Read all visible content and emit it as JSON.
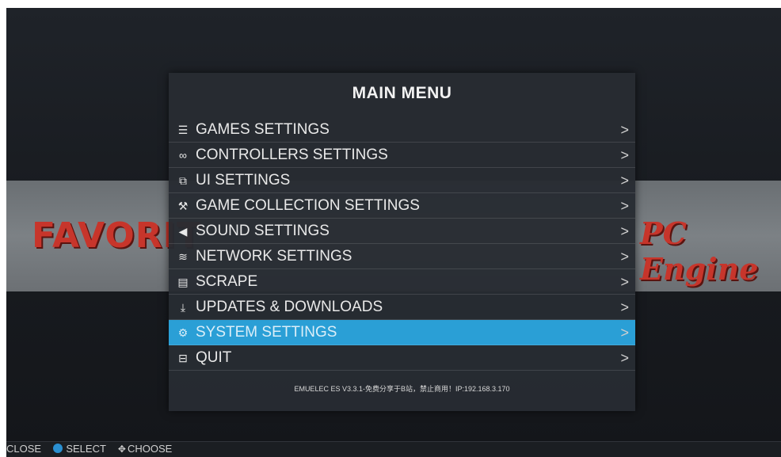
{
  "menu": {
    "title": "MAIN MENU",
    "items": [
      {
        "label": "GAMES SETTINGS",
        "icon": "sliders-icon",
        "glyph": "☰",
        "chevron": ">"
      },
      {
        "label": "CONTROLLERS SETTINGS",
        "icon": "gamepad-icon",
        "glyph": "∞",
        "chevron": ">"
      },
      {
        "label": "UI SETTINGS",
        "icon": "ui-icon",
        "glyph": "⧉",
        "chevron": ">"
      },
      {
        "label": "GAME COLLECTION SETTINGS",
        "icon": "wrench-icon",
        "glyph": "⚒",
        "chevron": ">"
      },
      {
        "label": "SOUND SETTINGS",
        "icon": "speaker-icon",
        "glyph": "◀",
        "chevron": ">"
      },
      {
        "label": "NETWORK SETTINGS",
        "icon": "wifi-icon",
        "glyph": "≋",
        "chevron": ">"
      },
      {
        "label": "SCRAPE",
        "icon": "scrape-icon",
        "glyph": "▤",
        "chevron": ">"
      },
      {
        "label": "UPDATES & DOWNLOADS",
        "icon": "download-icon",
        "glyph": "⤓",
        "chevron": ">"
      },
      {
        "label": "SYSTEM SETTINGS",
        "icon": "system-icon",
        "glyph": "⚙",
        "chevron": ">"
      },
      {
        "label": "QUIT",
        "icon": "quit-icon",
        "glyph": "⊟",
        "chevron": ">"
      }
    ],
    "selected_index": 8,
    "footer": "EMUELEC ES V3.3.1-免费分享于B站，禁止商用！IP:192.168.3.170"
  },
  "background": {
    "left_logo": "FAVORIT",
    "right_logo": "PC Engine"
  },
  "helpbar": {
    "close": "CLOSE",
    "select": "SELECT",
    "choose": "CHOOSE"
  },
  "colors": {
    "selected": "#2a9fd6",
    "menu_bg": "#282c32"
  }
}
